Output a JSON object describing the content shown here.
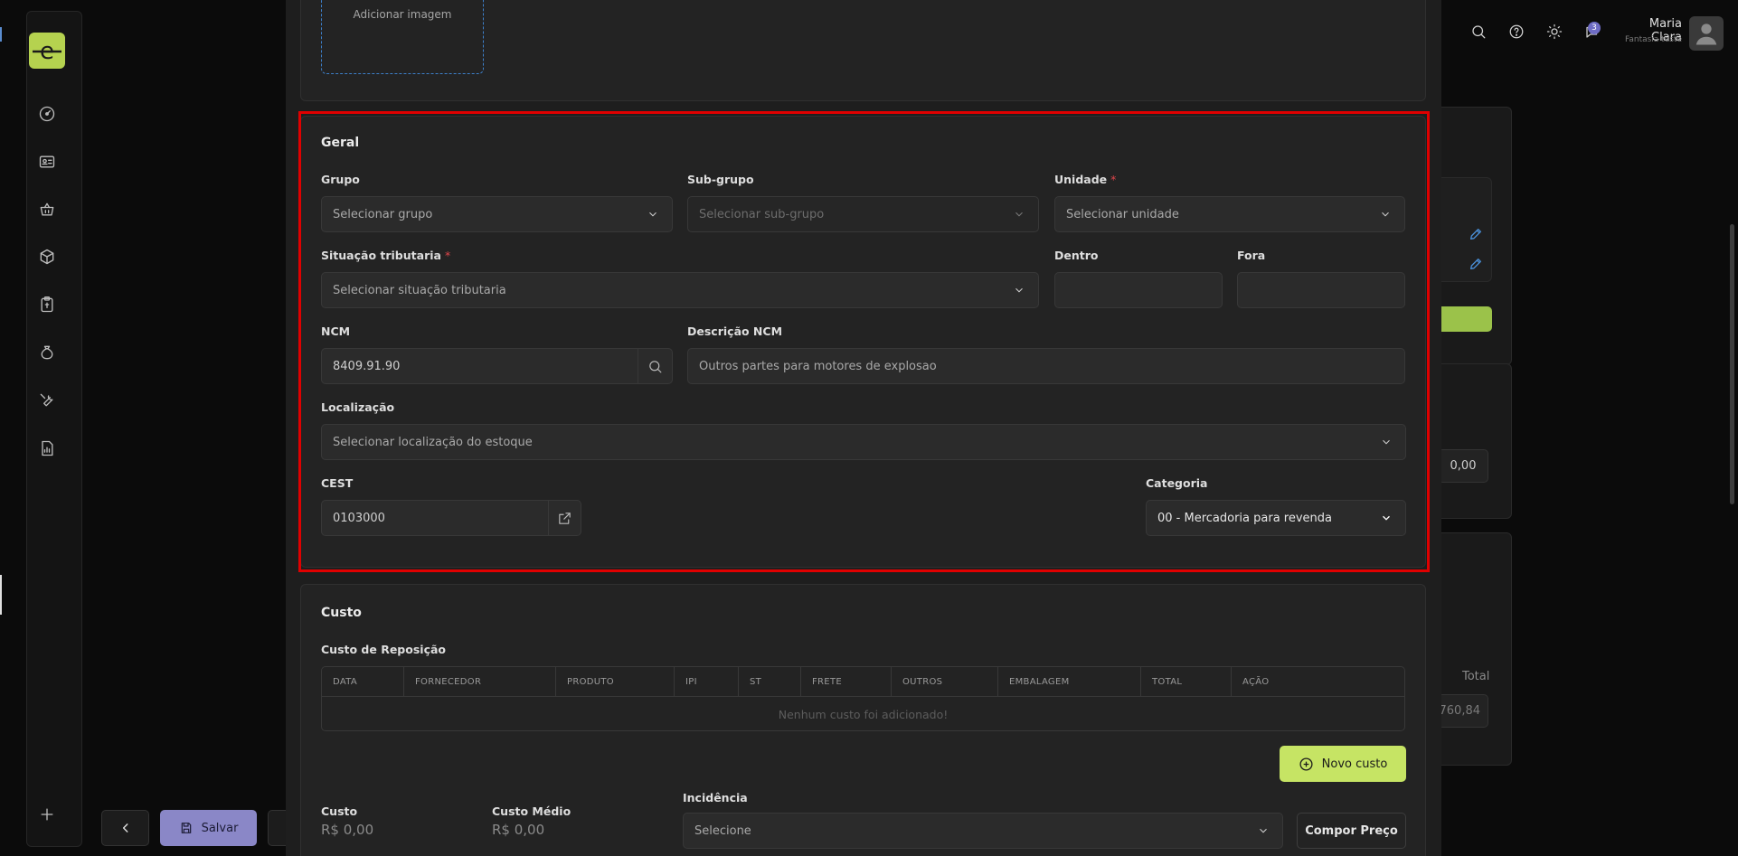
{
  "sidebar": {
    "logo_letter": "e"
  },
  "actions": {
    "save_label": "Salvar"
  },
  "topbar": {
    "notification_count": "3",
    "user_name": "Maria Clara",
    "user_subtitle": "Fantasia teste"
  },
  "background": {
    "value_1": "0,00",
    "total_label": "Total",
    "total_value": "760,84"
  },
  "upload": {
    "label": "Adicionar imagem"
  },
  "geral": {
    "title": "Geral",
    "grupo": {
      "label": "Grupo",
      "placeholder": "Selecionar grupo"
    },
    "subgrupo": {
      "label": "Sub-grupo",
      "placeholder": "Selecionar sub-grupo"
    },
    "unidade": {
      "label": "Unidade",
      "required_mark": "*",
      "placeholder": "Selecionar unidade"
    },
    "situacao": {
      "label": "Situação tributaria",
      "required_mark": "*",
      "placeholder": "Selecionar situação tributaria"
    },
    "dentro": {
      "label": "Dentro",
      "value": ""
    },
    "fora": {
      "label": "Fora",
      "value": ""
    },
    "ncm": {
      "label": "NCM",
      "value": "8409.91.90"
    },
    "descricao_ncm": {
      "label": "Descrição NCM",
      "value": "Outros partes para motores de explosao"
    },
    "localizacao": {
      "label": "Localização",
      "placeholder": "Selecionar localização do estoque"
    },
    "cest": {
      "label": "CEST",
      "value": "0103000"
    },
    "categoria": {
      "label": "Categoria",
      "value": "00 - Mercadoria para revenda"
    }
  },
  "custo": {
    "title": "Custo",
    "reposicao_label": "Custo de Reposição",
    "columns": [
      "DATA",
      "FORNECEDOR",
      "PRODUTO",
      "IPI",
      "ST",
      "FRETE",
      "OUTROS",
      "EMBALAGEM",
      "TOTAL",
      "AÇÃO"
    ],
    "empty_message": "Nenhum custo foi adicionado!",
    "new_button": "Novo custo",
    "custo_label": "Custo",
    "custo_value": "R$ 0,00",
    "custo_medio_label": "Custo Médio",
    "custo_medio_value": "R$ 0,00",
    "incidencia_label": "Incidência",
    "incidencia_placeholder": "Selecione",
    "compor_button": "Compor Preço"
  }
}
